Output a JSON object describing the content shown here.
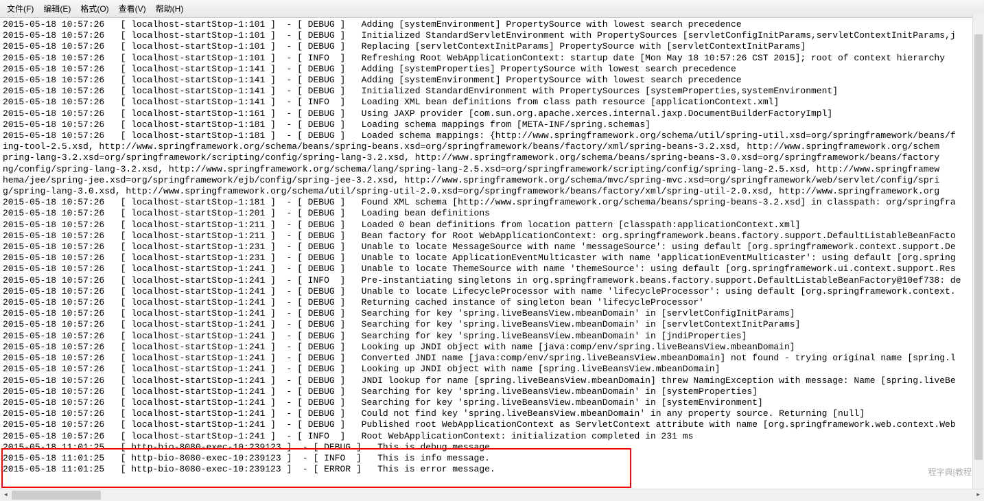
{
  "menu": {
    "file": "文件(F)",
    "edit": "编辑(E)",
    "format": "格式(O)",
    "view": "查看(V)",
    "help": "帮助(H)"
  },
  "log_rows": [
    {
      "ts": "2015-05-18 10:57:26",
      "src": "localhost-startStop-1:101",
      "lvl": "DEBUG",
      "msg": "Adding [systemEnvironment] PropertySource with lowest search precedence"
    },
    {
      "ts": "2015-05-18 10:57:26",
      "src": "localhost-startStop-1:101",
      "lvl": "DEBUG",
      "msg": "Initialized StandardServletEnvironment with PropertySources [servletConfigInitParams,servletContextInitParams,j"
    },
    {
      "ts": "2015-05-18 10:57:26",
      "src": "localhost-startStop-1:101",
      "lvl": "DEBUG",
      "msg": "Replacing [servletContextInitParams] PropertySource with [servletContextInitParams]"
    },
    {
      "ts": "2015-05-18 10:57:26",
      "src": "localhost-startStop-1:101",
      "lvl": "INFO",
      "msg": "Refreshing Root WebApplicationContext: startup date [Mon May 18 10:57:26 CST 2015]; root of context hierarchy"
    },
    {
      "ts": "2015-05-18 10:57:26",
      "src": "localhost-startStop-1:141",
      "lvl": "DEBUG",
      "msg": "Adding [systemProperties] PropertySource with lowest search precedence"
    },
    {
      "ts": "2015-05-18 10:57:26",
      "src": "localhost-startStop-1:141",
      "lvl": "DEBUG",
      "msg": "Adding [systemEnvironment] PropertySource with lowest search precedence"
    },
    {
      "ts": "2015-05-18 10:57:26",
      "src": "localhost-startStop-1:141",
      "lvl": "DEBUG",
      "msg": "Initialized StandardEnvironment with PropertySources [systemProperties,systemEnvironment]"
    },
    {
      "ts": "2015-05-18 10:57:26",
      "src": "localhost-startStop-1:141",
      "lvl": "INFO",
      "msg": "Loading XML bean definitions from class path resource [applicationContext.xml]"
    },
    {
      "ts": "2015-05-18 10:57:26",
      "src": "localhost-startStop-1:161",
      "lvl": "DEBUG",
      "msg": "Using JAXP provider [com.sun.org.apache.xerces.internal.jaxp.DocumentBuilderFactoryImpl]"
    },
    {
      "ts": "2015-05-18 10:57:26",
      "src": "localhost-startStop-1:181",
      "lvl": "DEBUG",
      "msg": "Loading schema mappings from [META-INF/spring.schemas]"
    },
    {
      "ts": "2015-05-18 10:57:26",
      "src": "localhost-startStop-1:181",
      "lvl": "DEBUG",
      "msg": "Loaded schema mappings: {http://www.springframework.org/schema/util/spring-util.xsd=org/springframework/beans/f"
    }
  ],
  "wrapped_lines": [
    "ing-tool-2.5.xsd, http://www.springframework.org/schema/beans/spring-beans.xsd=org/springframework/beans/factory/xml/spring-beans-3.2.xsd, http://www.springframework.org/schem",
    "pring-lang-3.2.xsd=org/springframework/scripting/config/spring-lang-3.2.xsd, http://www.springframework.org/schema/beans/spring-beans-3.0.xsd=org/springframework/beans/factory",
    "ng/config/spring-lang-3.2.xsd, http://www.springframework.org/schema/lang/spring-lang-2.5.xsd=org/springframework/scripting/config/spring-lang-2.5.xsd, http://www.springframew",
    "hema/jee/spring-jee.xsd=org/springframework/ejb/config/spring-jee-3.2.xsd, http://www.springframework.org/schema/mvc/spring-mvc.xsd=org/springframework/web/servlet/config/spri",
    "g/spring-lang-3.0.xsd, http://www.springframework.org/schema/util/spring-util-2.0.xsd=org/springframework/beans/factory/xml/spring-util-2.0.xsd, http://www.springframework.org"
  ],
  "log_rows2": [
    {
      "ts": "2015-05-18 10:57:26",
      "src": "localhost-startStop-1:181",
      "lvl": "DEBUG",
      "msg": "Found XML schema [http://www.springframework.org/schema/beans/spring-beans-3.2.xsd] in classpath: org/springfra"
    },
    {
      "ts": "2015-05-18 10:57:26",
      "src": "localhost-startStop-1:201",
      "lvl": "DEBUG",
      "msg": "Loading bean definitions"
    },
    {
      "ts": "2015-05-18 10:57:26",
      "src": "localhost-startStop-1:211",
      "lvl": "DEBUG",
      "msg": "Loaded 0 bean definitions from location pattern [classpath:applicationContext.xml]"
    },
    {
      "ts": "2015-05-18 10:57:26",
      "src": "localhost-startStop-1:211",
      "lvl": "DEBUG",
      "msg": "Bean factory for Root WebApplicationContext: org.springframework.beans.factory.support.DefaultListableBeanFacto"
    },
    {
      "ts": "2015-05-18 10:57:26",
      "src": "localhost-startStop-1:231",
      "lvl": "DEBUG",
      "msg": "Unable to locate MessageSource with name 'messageSource': using default [org.springframework.context.support.De"
    },
    {
      "ts": "2015-05-18 10:57:26",
      "src": "localhost-startStop-1:231",
      "lvl": "DEBUG",
      "msg": "Unable to locate ApplicationEventMulticaster with name 'applicationEventMulticaster': using default [org.spring"
    },
    {
      "ts": "2015-05-18 10:57:26",
      "src": "localhost-startStop-1:241",
      "lvl": "DEBUG",
      "msg": "Unable to locate ThemeSource with name 'themeSource': using default [org.springframework.ui.context.support.Res"
    },
    {
      "ts": "2015-05-18 10:57:26",
      "src": "localhost-startStop-1:241",
      "lvl": "INFO",
      "msg": "Pre-instantiating singletons in org.springframework.beans.factory.support.DefaultListableBeanFactory@10ef738: de"
    },
    {
      "ts": "2015-05-18 10:57:26",
      "src": "localhost-startStop-1:241",
      "lvl": "DEBUG",
      "msg": "Unable to locate LifecycleProcessor with name 'lifecycleProcessor': using default [org.springframework.context."
    },
    {
      "ts": "2015-05-18 10:57:26",
      "src": "localhost-startStop-1:241",
      "lvl": "DEBUG",
      "msg": "Returning cached instance of singleton bean 'lifecycleProcessor'"
    },
    {
      "ts": "2015-05-18 10:57:26",
      "src": "localhost-startStop-1:241",
      "lvl": "DEBUG",
      "msg": "Searching for key 'spring.liveBeansView.mbeanDomain' in [servletConfigInitParams]"
    },
    {
      "ts": "2015-05-18 10:57:26",
      "src": "localhost-startStop-1:241",
      "lvl": "DEBUG",
      "msg": "Searching for key 'spring.liveBeansView.mbeanDomain' in [servletContextInitParams]"
    },
    {
      "ts": "2015-05-18 10:57:26",
      "src": "localhost-startStop-1:241",
      "lvl": "DEBUG",
      "msg": "Searching for key 'spring.liveBeansView.mbeanDomain' in [jndiProperties]"
    },
    {
      "ts": "2015-05-18 10:57:26",
      "src": "localhost-startStop-1:241",
      "lvl": "DEBUG",
      "msg": "Looking up JNDI object with name [java:comp/env/spring.liveBeansView.mbeanDomain]"
    },
    {
      "ts": "2015-05-18 10:57:26",
      "src": "localhost-startStop-1:241",
      "lvl": "DEBUG",
      "msg": "Converted JNDI name [java:comp/env/spring.liveBeansView.mbeanDomain] not found - trying original name [spring.l"
    },
    {
      "ts": "2015-05-18 10:57:26",
      "src": "localhost-startStop-1:241",
      "lvl": "DEBUG",
      "msg": "Looking up JNDI object with name [spring.liveBeansView.mbeanDomain]"
    },
    {
      "ts": "2015-05-18 10:57:26",
      "src": "localhost-startStop-1:241",
      "lvl": "DEBUG",
      "msg": "JNDI lookup for name [spring.liveBeansView.mbeanDomain] threw NamingException with message: Name [spring.liveBe"
    },
    {
      "ts": "2015-05-18 10:57:26",
      "src": "localhost-startStop-1:241",
      "lvl": "DEBUG",
      "msg": "Searching for key 'spring.liveBeansView.mbeanDomain' in [systemProperties]"
    },
    {
      "ts": "2015-05-18 10:57:26",
      "src": "localhost-startStop-1:241",
      "lvl": "DEBUG",
      "msg": "Searching for key 'spring.liveBeansView.mbeanDomain' in [systemEnvironment]"
    },
    {
      "ts": "2015-05-18 10:57:26",
      "src": "localhost-startStop-1:241",
      "lvl": "DEBUG",
      "msg": "Could not find key 'spring.liveBeansView.mbeanDomain' in any property source. Returning [null]"
    },
    {
      "ts": "2015-05-18 10:57:26",
      "src": "localhost-startStop-1:241",
      "lvl": "DEBUG",
      "msg": "Published root WebApplicationContext as ServletContext attribute with name [org.springframework.web.context.Web"
    },
    {
      "ts": "2015-05-18 10:57:26",
      "src": "localhost-startStop-1:241",
      "lvl": "INFO",
      "msg": "Root WebApplicationContext: initialization completed in 231 ms"
    },
    {
      "ts": "2015-05-18 11:01:25",
      "src": "http-bio-8080-exec-10:239123",
      "lvl": "DEBUG",
      "msg": "This is debug message."
    },
    {
      "ts": "2015-05-18 11:01:25",
      "src": "http-bio-8080-exec-10:239123",
      "lvl": "INFO",
      "msg": "This is info message."
    },
    {
      "ts": "2015-05-18 11:01:25",
      "src": "http-bio-8080-exec-10:239123",
      "lvl": "ERROR",
      "msg": "This is error message."
    }
  ],
  "watermark": "程字典[教程网"
}
